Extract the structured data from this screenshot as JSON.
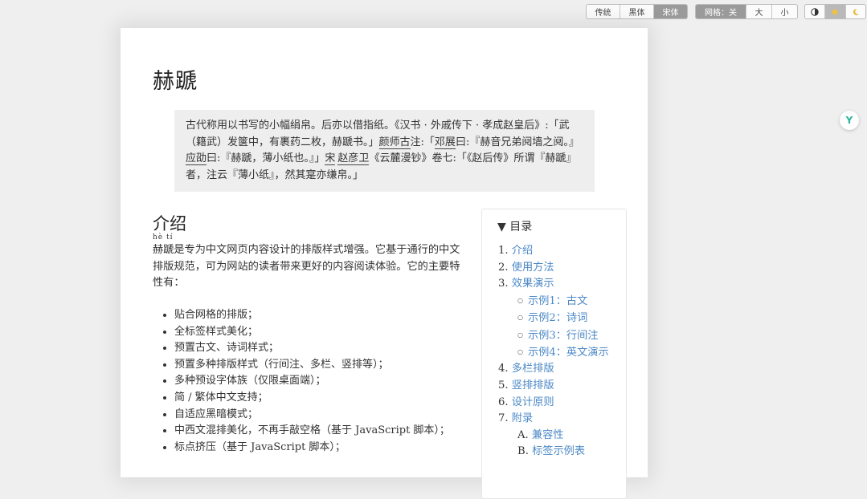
{
  "toolbar": {
    "fonts": [
      "传统",
      "黑体",
      "宋体"
    ],
    "active_font": "宋体",
    "grid_label": "网格：关",
    "grid_sizes": [
      "大",
      "小"
    ],
    "themes": [
      "contrast-icon",
      "sun-icon",
      "moon-icon"
    ]
  },
  "article": {
    "title": "赫蹏",
    "quote": {
      "p1": "古代称用以书写的小幅绢帛。后亦以借指纸。《汉书 · 外戚传下 · 孝成赵皇后》:「武（籍武）发箧中，有裹药二枚，赫蹏书。」",
      "name1": "颜师古",
      "p2": "注:「",
      "name2": "邓展",
      "p3": "曰:『赫音兄弟阋墙之阋。』",
      "name3": "应劭",
      "p4": "曰:『赫蹏，薄小纸也。』」",
      "name4": "宋",
      "name5": "赵彦卫",
      "p5": "《云麓漫钞》卷七:「《赵后传》所谓『赫蹏』者，注云『薄小纸』，然其寔亦缣帛。」"
    },
    "section_title": "介绍",
    "ruby": "hè tí",
    "intro": "赫蹏是专为中文网页内容设计的排版样式增强。它基于通行的中文排版规范，可为网站的读者带来更好的内容阅读体验。它的主要特性有：",
    "features": [
      "贴合网格的排版；",
      "全标签样式美化；",
      "预置古文、诗词样式；",
      "预置多种排版样式（行间注、多栏、竖排等）；",
      "多种预设字体族（仅限桌面端）；",
      "简 / 繁体中文支持；",
      "自适应黑暗模式；",
      "中西文混排美化，不再手敲空格（基于 JavaScript 脚本）；",
      "标点挤压（基于 JavaScript 脚本）；"
    ]
  },
  "toc": {
    "heading": "▼ 目录",
    "items": [
      {
        "num": "1.",
        "label": "介绍"
      },
      {
        "num": "2.",
        "label": "使用方法"
      },
      {
        "num": "3.",
        "label": "效果演示"
      }
    ],
    "sub_items": [
      "示例1：古文",
      "示例2：诗词",
      "示例3：行间注",
      "示例4：英文演示"
    ],
    "items2": [
      {
        "num": "4.",
        "label": "多栏排版"
      },
      {
        "num": "5.",
        "label": "竖排排版"
      },
      {
        "num": "6.",
        "label": "设计原则"
      },
      {
        "num": "7.",
        "label": "附录"
      }
    ],
    "appendix": [
      {
        "num": "A.",
        "label": "兼容性"
      },
      {
        "num": "B.",
        "label": "标签示例表"
      }
    ]
  },
  "side_icon": "Y"
}
